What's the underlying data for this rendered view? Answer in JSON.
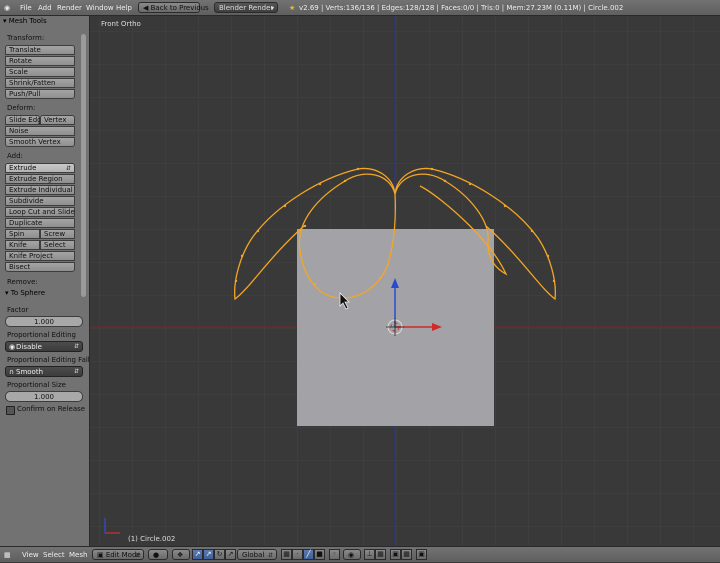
{
  "menu": {
    "file": "File",
    "add": "Add",
    "render": "Render",
    "window": "Window",
    "help": "Help",
    "back": "Back to Previous",
    "engine": "Blender Render",
    "stats": "v2.69 | Verts:136/136 | Edges:128/128 | Faces:0/0 | Tris:0 | Mem:27.23M (0.11M) | Circle.002"
  },
  "panel": {
    "title": "Mesh Tools",
    "transform_label": "Transform:",
    "translate": "Translate",
    "rotate": "Rotate",
    "scale": "Scale",
    "shrink": "Shrink/Fatten",
    "push": "Push/Pull",
    "deform_label": "Deform:",
    "slide_edge": "Slide Edge",
    "vertex": "Vertex",
    "noise": "Noise",
    "smooth_vertex": "Smooth Vertex",
    "add_label": "Add:",
    "extrude": "Extrude",
    "extrude_region": "Extrude Region",
    "extrude_individual": "Extrude Individual",
    "subdivide": "Subdivide",
    "loop_cut": "Loop Cut and Slide",
    "duplicate": "Duplicate",
    "spin": "Spin",
    "screw": "Screw",
    "knife": "Knife",
    "select": "Select",
    "knife_project": "Knife Project",
    "bisect": "Bisect",
    "remove_label": "Remove:",
    "operator_title": "To Sphere",
    "factor_label": "Factor",
    "factor_value": "1.000",
    "prop_edit_label": "Proportional Editing",
    "prop_edit_value": "Disable",
    "falloff_label": "Proportional Editing Falloff",
    "falloff_value": "Smooth",
    "prop_size_label": "Proportional Size",
    "prop_size_value": "1.000",
    "confirm_label": "Confirm on Release"
  },
  "viewport": {
    "view_name": "Front Ortho",
    "object_label": "(1) Circle.002",
    "colors": {
      "background": "#393939",
      "grid": "#444444",
      "x_axis": "#8a2a2a",
      "z_axis": "#2a3ea0",
      "selection": "#f5a623",
      "plane": "#a3a3a7"
    }
  },
  "bottom": {
    "view": "View",
    "select": "Select",
    "mesh": "Mesh",
    "mode": "Edit Mode",
    "orientation": "Global"
  }
}
